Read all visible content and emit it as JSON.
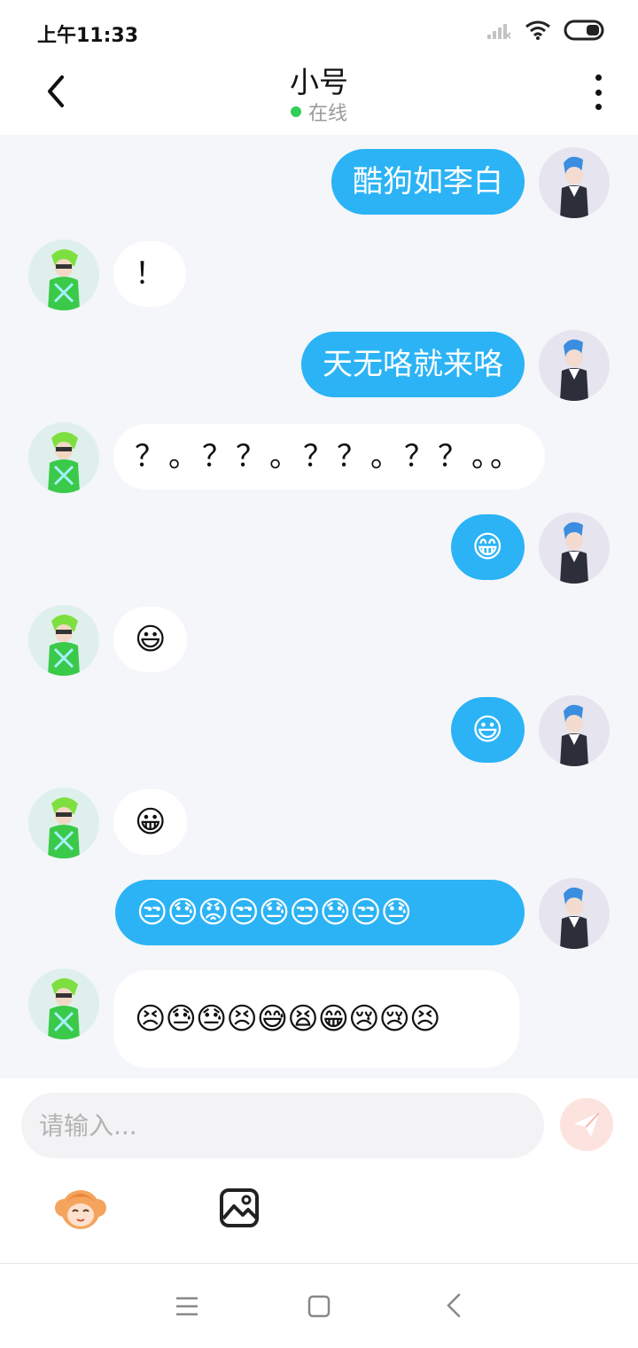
{
  "status_bar": {
    "time": "上午11:33"
  },
  "header": {
    "title": "小号",
    "status": "在线"
  },
  "messages": [
    {
      "side": "me",
      "text": "酷狗如李白"
    },
    {
      "side": "other",
      "text": "！"
    },
    {
      "side": "me",
      "text": "天无咯就来咯"
    },
    {
      "side": "other",
      "text": "？。？？。？？。？？。。"
    },
    {
      "side": "me",
      "text": "😁"
    },
    {
      "side": "other",
      "text": "😃"
    },
    {
      "side": "me",
      "text": "😃"
    },
    {
      "side": "other",
      "text": "😀"
    },
    {
      "side": "me",
      "text": "😒😓😡😒😓😒😓😒😓"
    },
    {
      "side": "other",
      "text": "😣😓😓😣😅😫😁😢😢😣"
    }
  ],
  "input": {
    "placeholder": "请输入..."
  },
  "icons": {
    "back": "chevron-left-icon",
    "more": "more-vertical-icon",
    "send": "paper-plane-icon",
    "sticker": "cartoon-face-icon",
    "image": "image-icon"
  },
  "colors": {
    "my_bubble": "#2bb3f5",
    "their_bubble": "#ffffff",
    "chat_background": "#f4f6f9",
    "online": "#2fcf5a",
    "send_button": "#fde3df"
  }
}
